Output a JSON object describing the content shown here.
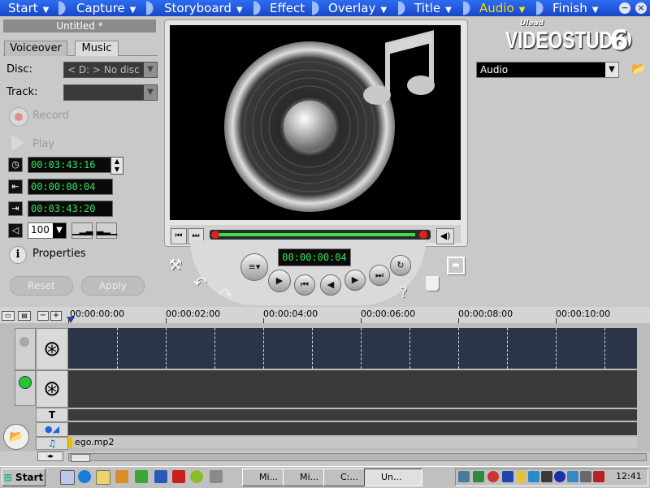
{
  "menu": {
    "items": [
      {
        "label": "Start",
        "arrow": "▼"
      },
      {
        "label": "Capture",
        "arrow": "▼"
      },
      {
        "label": "Storyboard",
        "arrow": "▼"
      },
      {
        "label": "Effect",
        "arrow": ""
      },
      {
        "label": "Overlay",
        "arrow": "▼"
      },
      {
        "label": "Title",
        "arrow": "▼"
      },
      {
        "label": "Audio",
        "arrow": "▼"
      },
      {
        "label": "Finish",
        "arrow": "▼"
      }
    ],
    "active": "Audio",
    "minimize": "−",
    "close": "×"
  },
  "left_panel": {
    "project_title": "Untitled *",
    "tabs": {
      "voiceover": "Voiceover",
      "music": "Music"
    },
    "disc_label": "Disc:",
    "disc_value": "< D: > No disc",
    "track_label": "Track:",
    "track_value": "",
    "record_label": "Record",
    "play_label": "Play",
    "timecode_duration": "00:03:43:16",
    "timecode_mark_in": "00:00:00:04",
    "timecode_mark_out": "00:03:43:20",
    "volume_value": "100",
    "properties_label": "Properties",
    "reset_label": "Reset",
    "apply_label": "Apply"
  },
  "preview": {
    "timecode": "00:00:00:04",
    "progress": 0.97
  },
  "right_panel": {
    "logo_brand": "Ulead",
    "logo_product": "VIDEOSTUDIO",
    "logo_version": "6",
    "library_select": "Audio"
  },
  "timeline": {
    "ruler_labels": [
      "00:00:00:00",
      "00:00:02:00",
      "00:00:04:00",
      "00:00:06:00",
      "00:00:08:00",
      "00:00:10:00"
    ],
    "music_clip": "ego.mp2"
  },
  "taskbar": {
    "start_label": "Start",
    "tasks": [
      {
        "label": "Mi..."
      },
      {
        "label": "Mi..."
      },
      {
        "label": "C:..."
      },
      {
        "label": "Un...",
        "active": true
      }
    ],
    "clock": "12:41"
  },
  "colors": {
    "menu_blue": "#1f4fd0",
    "active_menu": "#ffde00",
    "timecode_green": "#33e35a"
  }
}
